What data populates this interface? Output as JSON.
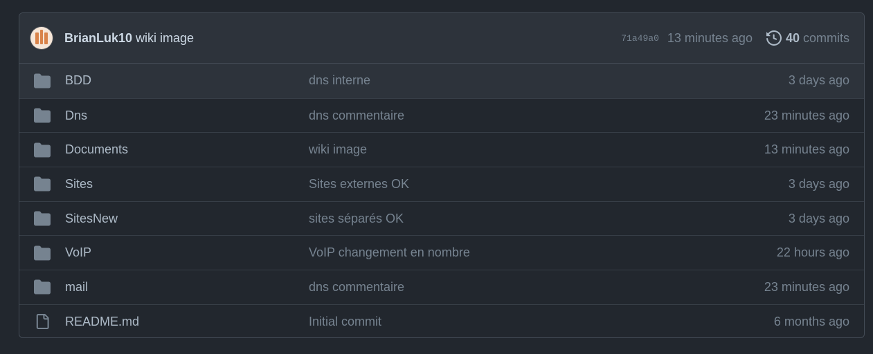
{
  "commit": {
    "author": "BrianLuk10",
    "message": "wiki image",
    "sha": "71a49a0",
    "time": "13 minutes ago",
    "commits_count": "40",
    "commits_label": "commits"
  },
  "files": [
    {
      "name": "BDD",
      "type": "folder",
      "message": "dns interne",
      "age": "3 days ago"
    },
    {
      "name": "Dns",
      "type": "folder",
      "message": "dns commentaire",
      "age": "23 minutes ago"
    },
    {
      "name": "Documents",
      "type": "folder",
      "message": "wiki image",
      "age": "13 minutes ago"
    },
    {
      "name": "Sites",
      "type": "folder",
      "message": "Sites externes OK",
      "age": "3 days ago"
    },
    {
      "name": "SitesNew",
      "type": "folder",
      "message": "sites séparés OK",
      "age": "3 days ago"
    },
    {
      "name": "VoIP",
      "type": "folder",
      "message": "VoIP changement en nombre",
      "age": "22 hours ago"
    },
    {
      "name": "mail",
      "type": "folder",
      "message": "dns commentaire",
      "age": "23 minutes ago"
    },
    {
      "name": "README.md",
      "type": "file",
      "message": "Initial commit",
      "age": "6 months ago"
    }
  ],
  "colors": {
    "folder_icon": "#768390",
    "file_icon": "#768390",
    "avatar_accent": "#d9834a"
  }
}
